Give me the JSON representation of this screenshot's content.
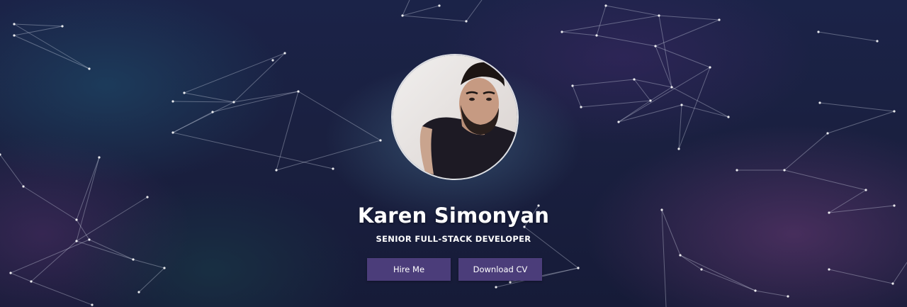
{
  "hero": {
    "name": "Karen Simonyan",
    "title": "SENIOR FULL-STACK DEVELOPER",
    "hire_label": "Hire Me",
    "cv_label": "Download CV",
    "accent_color": "#4b3d7a",
    "avatar_alt": "Karen Simonyan"
  }
}
